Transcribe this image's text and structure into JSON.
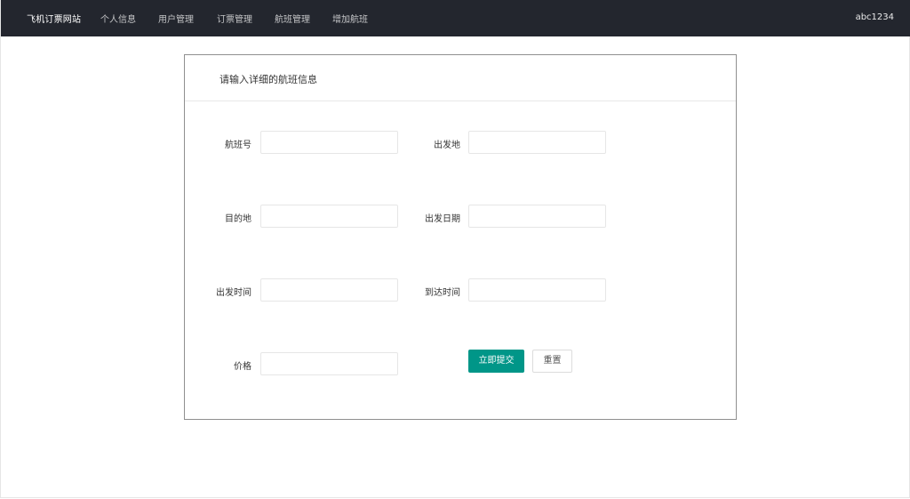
{
  "navbar": {
    "brand": "飞机订票网站",
    "items": [
      {
        "label": "个人信息"
      },
      {
        "label": "用户管理"
      },
      {
        "label": "订票管理"
      },
      {
        "label": "航班管理"
      },
      {
        "label": "增加航班"
      }
    ],
    "username": "abc1234"
  },
  "form": {
    "title": "请输入详细的航班信息",
    "fields": {
      "flight_no": {
        "label": "航班号",
        "value": ""
      },
      "departure_place": {
        "label": "出发地",
        "value": ""
      },
      "destination": {
        "label": "目的地",
        "value": ""
      },
      "departure_date": {
        "label": "出发日期",
        "value": ""
      },
      "departure_time": {
        "label": "出发时间",
        "value": ""
      },
      "arrival_time": {
        "label": "到达时间",
        "value": ""
      },
      "price": {
        "label": "价格",
        "value": ""
      }
    },
    "submit_label": "立即提交",
    "reset_label": "重置"
  },
  "colors": {
    "navbar_bg": "#23262e",
    "primary": "#009688"
  }
}
